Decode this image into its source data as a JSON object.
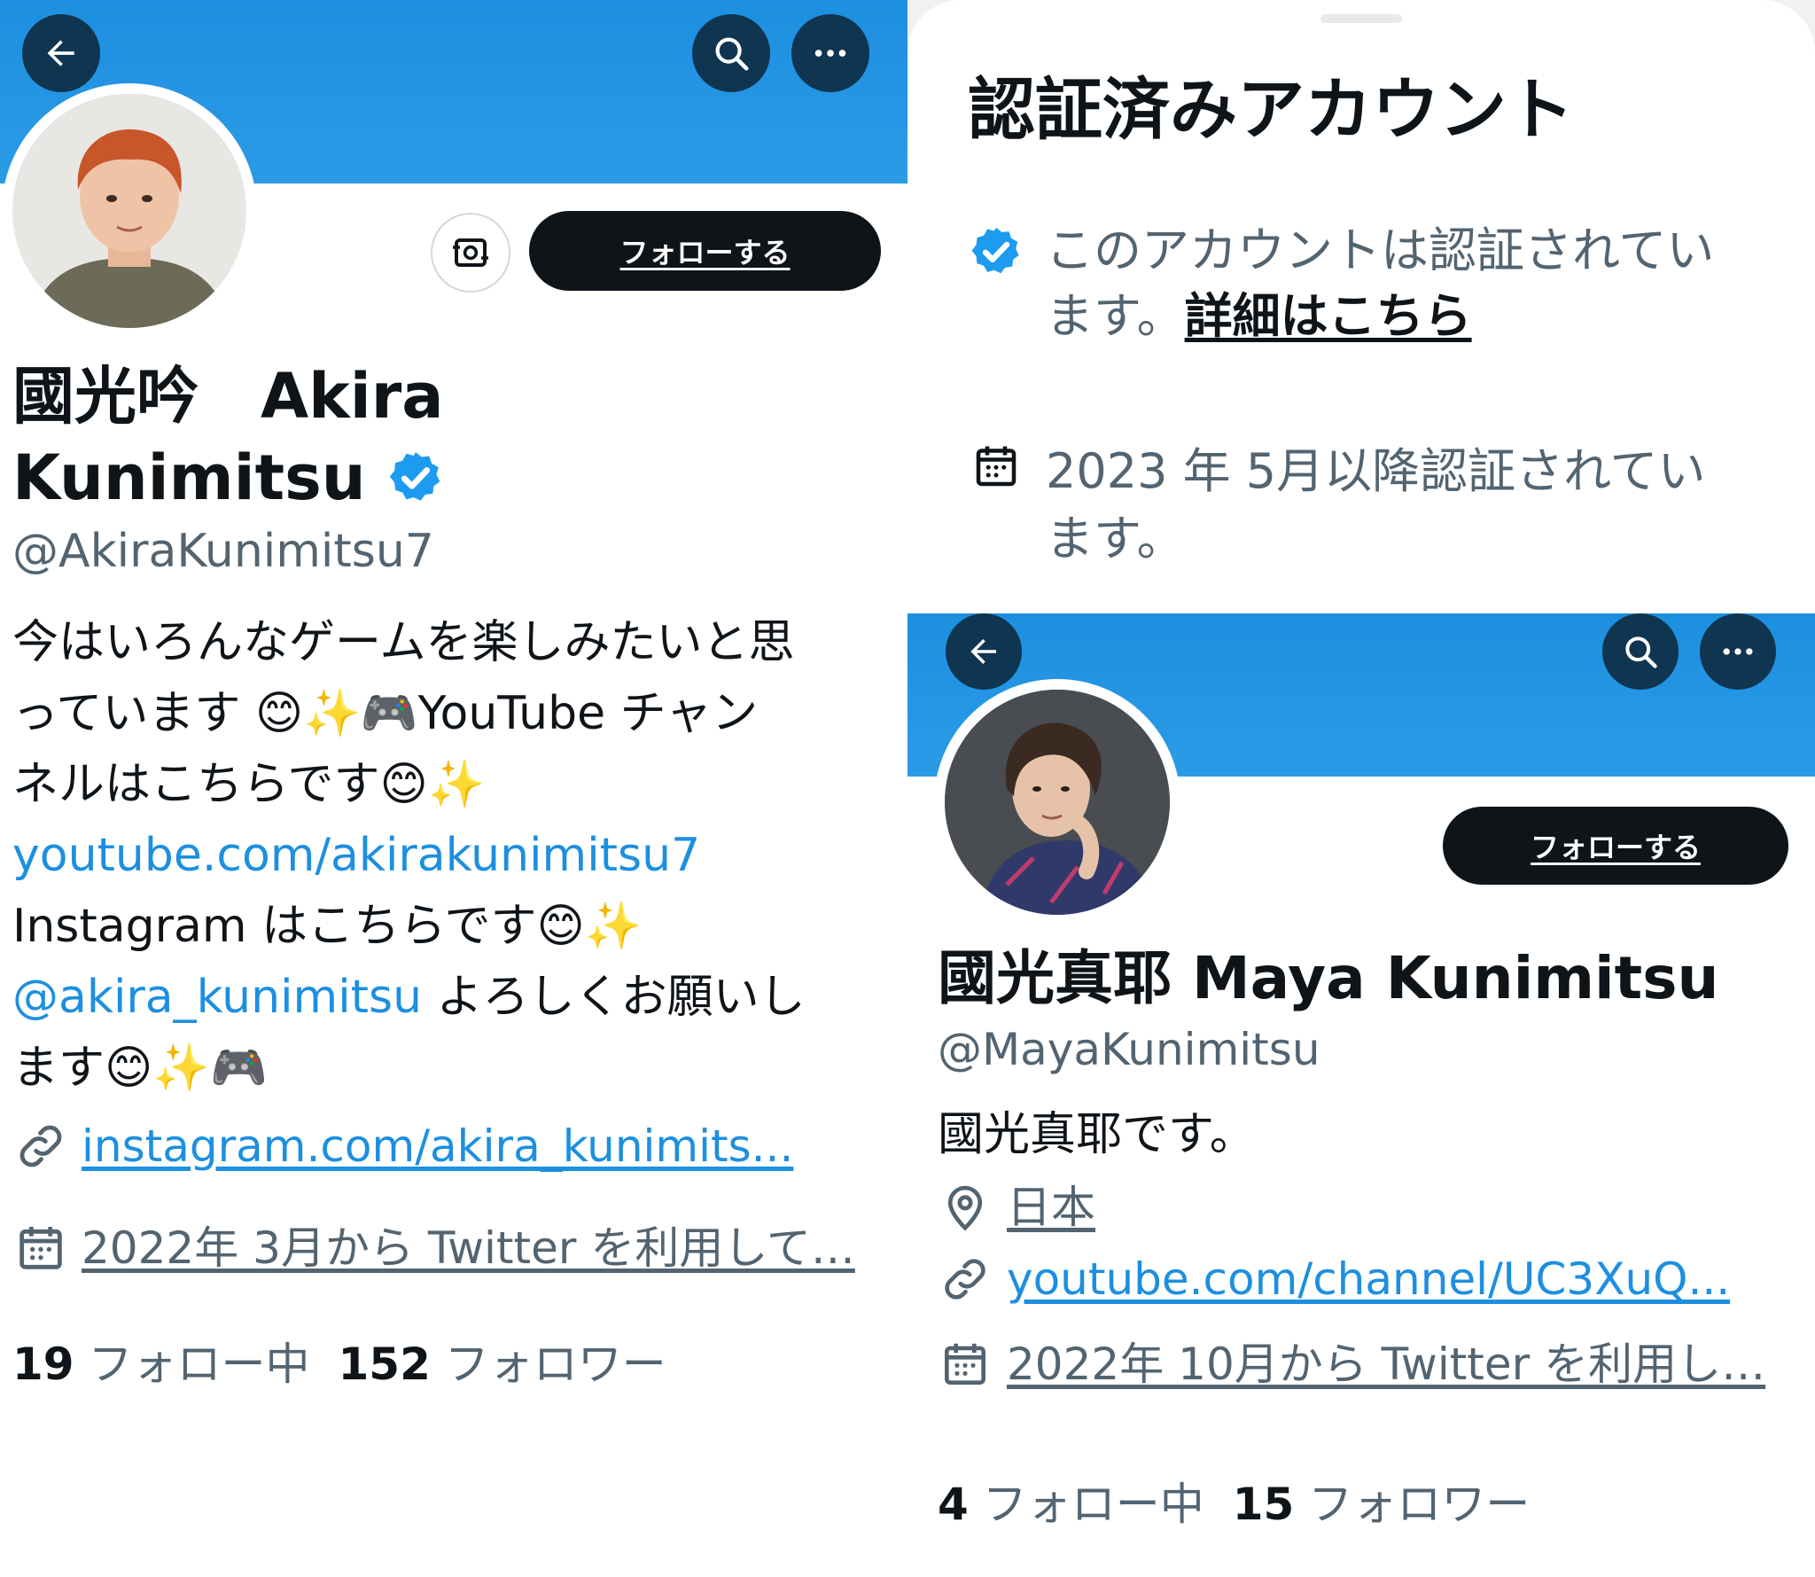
{
  "left": {
    "follow_label": "フォローする",
    "name_line1": "國光吟　Akira",
    "name_line2": "Kunimitsu",
    "handle": "@AkiraKunimitsu7",
    "bio": {
      "line1": "今はいろんなゲームを楽しみたいと思",
      "line2a": "っています",
      "line2b": "YouTube チャン",
      "line3a": "ネルはこちらです",
      "line4": "youtube.com/akirakunimitsu7",
      "line5a": "Instagram はこちらです",
      "line6_mention": "@akira_kunimitsu",
      "line6b": " よろしくお願いし",
      "line7a": "ます"
    },
    "website": "instagram.com/akira_kunimits...",
    "joined": "2022年 3月から Twitter を利用して…",
    "following_count": "19",
    "following_label": "フォロー中",
    "followers_count": "152",
    "followers_label": "フォロワー"
  },
  "sheet": {
    "title": "認証済みアカウント",
    "verified_text_line1": "このアカウントは認証されてい",
    "verified_text_line2": "ます。",
    "learn_more": "詳細はこちら",
    "since_line1": "2023 年 5月以降認証されてい",
    "since_line2": "ます。"
  },
  "right": {
    "follow_label": "フォローする",
    "name": "國光真耶 Maya Kunimitsu",
    "handle": "@MayaKunimitsu",
    "bio": "國光真耶です。",
    "location": "日本",
    "website": "youtube.com/channel/UC3XuQ...",
    "joined": "2022年 10月から Twitter を利用し…",
    "following_count": "4",
    "following_label": "フォロー中",
    "followers_count": "15",
    "followers_label": "フォロワー"
  },
  "colors": {
    "banner_blue": "#1d8fe0",
    "link_blue": "#1d8fe0",
    "verified_blue": "#1d9bf0",
    "follow_button": "#0f1419",
    "secondary_text": "#536471"
  },
  "icons": {
    "back": "arrow-left-icon",
    "search": "search-icon",
    "more": "more-icon",
    "verified": "verified-badge-icon",
    "link": "link-icon",
    "calendar": "calendar-icon",
    "location": "location-pin-icon",
    "switch_account": "account-switch-icon"
  }
}
